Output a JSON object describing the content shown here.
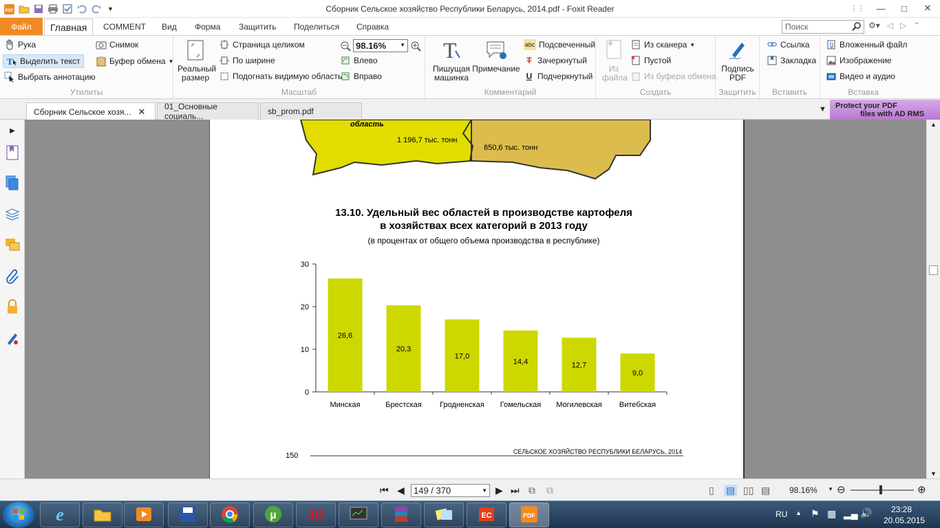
{
  "window": {
    "title": "Сборник Сельское хозяйство Республики Беларусь, 2014.pdf - Foxit Reader"
  },
  "menu": {
    "file": "Файл",
    "tabs": [
      "Главная",
      "COMMENT",
      "Вид",
      "Форма",
      "Защитить",
      "Поделиться",
      "Справка"
    ],
    "search_placeholder": "Поиск"
  },
  "ribbon": {
    "utilities": {
      "label": "Утилиты",
      "hand": "Рука",
      "select_text": "Выделить текст",
      "select_annotation": "Выбрать аннотацию",
      "snapshot": "Снимок",
      "clipboard": "Буфер обмена"
    },
    "zoom": {
      "label": "Масштаб",
      "actual_size": "Реальный размер",
      "fit_page": "Страница целиком",
      "fit_width": "По ширине",
      "fit_visible": "Подогнать видимую область",
      "value": "98.16%",
      "rotate_left": "Влево",
      "rotate_right": "Вправо"
    },
    "comment": {
      "label": "Комментарий",
      "typewriter": "Пишущая машинка",
      "note": "Примечание",
      "highlight": "Подсвеченный",
      "strikeout": "Зачеркнутый",
      "underline": "Подчеркнутый"
    },
    "create": {
      "label": "Создать",
      "from_file": "Из файла",
      "from_scanner": "Из сканера",
      "blank": "Пустой",
      "from_clipboard": "Из буфера обмена"
    },
    "protect": {
      "label": "Защитить",
      "sign": "Подпись PDF"
    },
    "insert1": {
      "label": "Вставить",
      "link": "Ссылка",
      "bookmark": "Закладка"
    },
    "insert2": {
      "label": "Вставка",
      "attachment": "Вложенный файл",
      "image": "Изображение",
      "video": "Видео и аудио"
    }
  },
  "doc_tabs": [
    "Сборник Сельское хозя...",
    "01_Основные социаль...",
    "sb_prom.pdf"
  ],
  "promo": {
    "line1": "Protect your PDF",
    "line2": "files with AD RMS"
  },
  "page": {
    "map_label_region": "область",
    "map_value_1": "1 196,7 тыс. тонн",
    "map_value_2": "850,6 тыс. тонн",
    "heading_line1": "13.10. Удельный вес областей в производстве картофеля",
    "heading_line2": "в хозяйствах всех категорий в 2013 году",
    "subtitle": "(в процентах от общего объема производства в республике)",
    "page_number": "150",
    "footer": "СЕЛЬСКОЕ ХОЗЯЙСТВО РЕСПУБЛИКИ БЕЛАРУСЬ, 2014"
  },
  "chart_data": {
    "type": "bar",
    "categories": [
      "Минская",
      "Брестская",
      "Гродненская",
      "Гомельская",
      "Могилевская",
      "Витебская"
    ],
    "values": [
      26.6,
      20.3,
      17.0,
      14.4,
      12.7,
      9.0
    ],
    "value_labels": [
      "26,6",
      "20,3",
      "17,0",
      "14,4",
      "12,7",
      "9,0"
    ],
    "yticks": [
      "0",
      "10",
      "20",
      "30"
    ],
    "ylim": [
      0,
      30
    ],
    "bar_color": "#cdd800",
    "grid": false,
    "legend": false
  },
  "status": {
    "page_indicator": "149 / 370",
    "zoom": "98.16%"
  },
  "taskbar": {
    "lang": "RU",
    "time": "23:28",
    "date": "20.05.2015"
  },
  "colors": {
    "file_tab": "#f08a24",
    "map_yellow": "#e2dc00",
    "map_tan": "#dcbc4c"
  }
}
